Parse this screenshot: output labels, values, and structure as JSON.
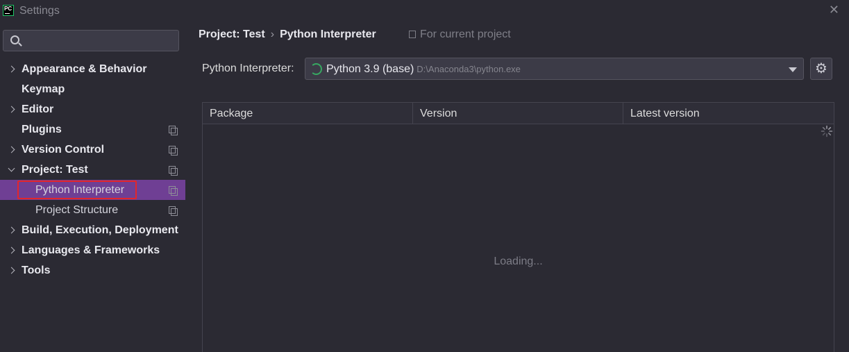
{
  "window": {
    "title": "Settings",
    "app_icon_text": "PC"
  },
  "sidebar": {
    "search": {
      "value": "",
      "placeholder": ""
    },
    "items": [
      {
        "label": "Appearance & Behavior",
        "expandable": true,
        "expanded": false,
        "scope_icon": false
      },
      {
        "label": "Keymap",
        "expandable": false,
        "scope_icon": false
      },
      {
        "label": "Editor",
        "expandable": true,
        "expanded": false,
        "scope_icon": false
      },
      {
        "label": "Plugins",
        "expandable": false,
        "scope_icon": true
      },
      {
        "label": "Version Control",
        "expandable": true,
        "expanded": false,
        "scope_icon": true
      },
      {
        "label": "Project: Test",
        "expandable": true,
        "expanded": true,
        "scope_icon": true
      },
      {
        "label": "Python Interpreter",
        "child": true,
        "selected": true,
        "scope_icon": true
      },
      {
        "label": "Project Structure",
        "child": true,
        "scope_icon": true
      },
      {
        "label": "Build, Execution, Deployment",
        "expandable": true,
        "expanded": false,
        "scope_icon": false
      },
      {
        "label": "Languages & Frameworks",
        "expandable": true,
        "expanded": false,
        "scope_icon": false
      },
      {
        "label": "Tools",
        "expandable": true,
        "expanded": false,
        "scope_icon": false
      }
    ]
  },
  "main": {
    "breadcrumb": {
      "parent": "Project: Test",
      "separator": "›",
      "current": "Python Interpreter"
    },
    "for_current_project": "For current project",
    "interpreter": {
      "label": "Python Interpreter:",
      "name": "Python 3.9 (base)",
      "path": "D:\\Anaconda3\\python.exe"
    },
    "table": {
      "columns": [
        "Package",
        "Version",
        "Latest version"
      ],
      "rows": [],
      "status": "Loading..."
    }
  },
  "colors": {
    "background": "#2b2a33",
    "selected": "#6f3f94",
    "highlight_border": "#e3262b",
    "interpreter_icon": "#37a862"
  }
}
